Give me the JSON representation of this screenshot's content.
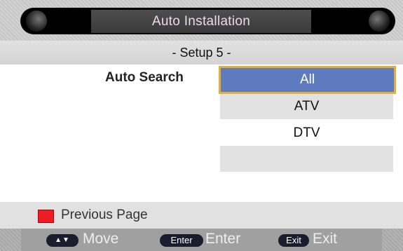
{
  "header": {
    "title": "Auto Installation"
  },
  "subheader": {
    "step": "- Setup 5 -"
  },
  "auto_search": {
    "label": "Auto Search",
    "options": [
      "All",
      "ATV",
      "DTV",
      ""
    ],
    "selected": "All"
  },
  "previous_page": {
    "label": "Previous Page",
    "key_color": "#ee1c24"
  },
  "footer": {
    "move": {
      "key": "▲▼",
      "label": "Move"
    },
    "enter": {
      "key": "Enter",
      "label": "Enter"
    },
    "exit": {
      "key": "Exit",
      "label": "Exit"
    }
  },
  "colors": {
    "selected_bg": "#5e7bc0",
    "selected_border": "#e1ad3b",
    "title_text": "#f0d8ee"
  }
}
